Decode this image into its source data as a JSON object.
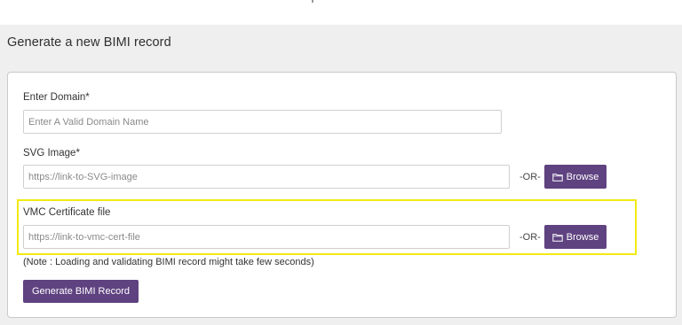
{
  "page": {
    "section_title": "Generate a new BIMI record"
  },
  "form": {
    "domain": {
      "label": "Enter Domain*",
      "placeholder": "Enter A Valid Domain Name",
      "value": ""
    },
    "svg": {
      "label": "SVG Image*",
      "placeholder": "https://link-to-SVG-image",
      "value": "",
      "or_text": "-OR-",
      "browse_label": "Browse",
      "browse_icon": "folder-icon"
    },
    "vmc": {
      "label": "VMC Certificate file",
      "placeholder": "https://link-to-vmc-cert-file",
      "value": "",
      "or_text": "-OR-",
      "browse_label": "Browse",
      "browse_icon": "folder-icon"
    },
    "note": "(Note : Loading and validating BIMI record might take few seconds)",
    "submit_label": "Generate BIMI Record"
  },
  "colors": {
    "button": "#5f4280",
    "highlight": "#f2ea12",
    "section_background": "#efefef"
  }
}
